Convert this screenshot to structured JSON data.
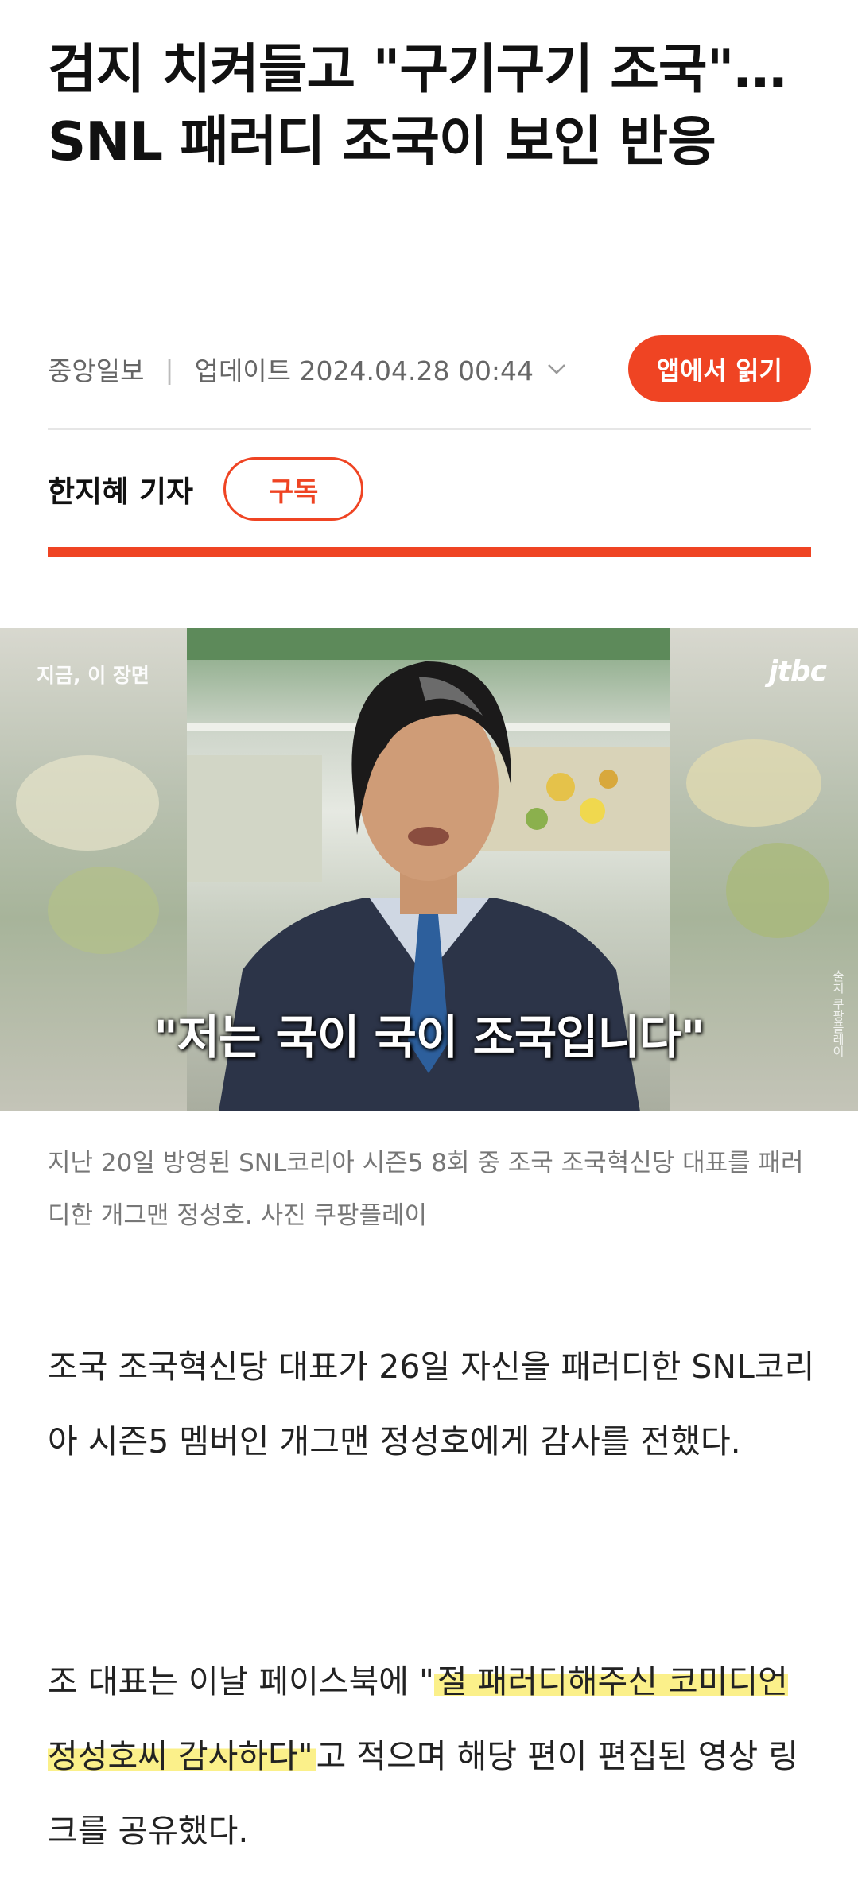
{
  "article": {
    "title": "검지 치켜들고 \"구기구기 조국\"…SNL 패러디 조국이 보인 반응",
    "source": "중앙일보",
    "separator": "|",
    "updated": "업데이트 2024.04.28 00:44",
    "app_button": "앱에서 읽기",
    "reporter": "한지혜 기자",
    "subscribe": "구독"
  },
  "photo": {
    "tag": "지금, 이 장면",
    "logo": "jtbc",
    "subtitle": "\"저는 국이 국이 조국입니다\"",
    "credit": "출처 쿠팡플레이"
  },
  "caption": "지난 20일 방영된 SNL코리아 시즌5 8회 중 조국 조국혁신당 대표를 패러디한 개그맨 정성호. 사진 쿠팡플레이",
  "body": {
    "p1": "조국 조국혁신당 대표가 26일 자신을 패러디한 SNL코리아 시즌5 멤버인 개그맨 정성호에게 감사를 전했다.",
    "p2_before": "조 대표는 이날 페이스북에 \"",
    "p2_highlight": "절 패러디해주신 코미디언 정성호씨 감사하다\"",
    "p2_after": "고 적으며 해당 편이 편집된 영상 링크를 공유했다."
  },
  "colors": {
    "accent": "#ef4423",
    "highlight": "#fbf08a"
  }
}
